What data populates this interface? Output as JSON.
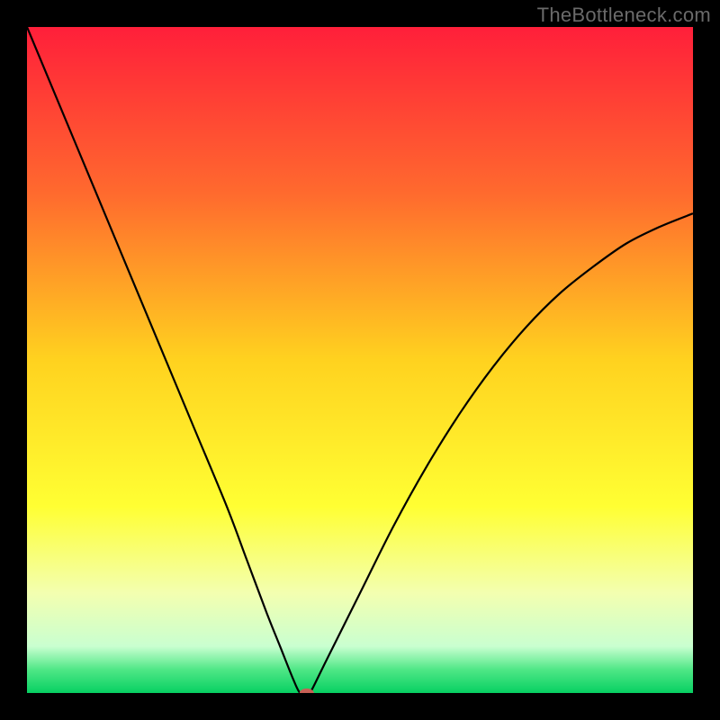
{
  "watermark": "TheBottleneck.com",
  "chart_data": {
    "type": "line",
    "title": "",
    "xlabel": "",
    "ylabel": "",
    "xlim": [
      0,
      100
    ],
    "ylim": [
      0,
      100
    ],
    "grid": false,
    "legend": false,
    "series": [
      {
        "name": "curve",
        "x": [
          0,
          5,
          10,
          15,
          20,
          25,
          30,
          33,
          36,
          38,
          40,
          41,
          42,
          42.5,
          45,
          50,
          55,
          60,
          65,
          70,
          75,
          80,
          85,
          90,
          95,
          100
        ],
        "y": [
          100,
          88,
          76,
          64,
          52,
          40,
          28,
          20,
          12,
          7,
          2,
          0,
          0,
          0,
          5,
          15,
          25,
          34,
          42,
          49,
          55,
          60,
          64,
          67.5,
          70,
          72
        ]
      }
    ],
    "marker": {
      "x": 42,
      "y": 0,
      "color": "#c76055",
      "rx": 8,
      "ry": 5
    },
    "background_gradient": {
      "stops": [
        {
          "offset": 0.0,
          "color": "#ff1f3a"
        },
        {
          "offset": 0.25,
          "color": "#ff6a2e"
        },
        {
          "offset": 0.5,
          "color": "#ffd21f"
        },
        {
          "offset": 0.72,
          "color": "#ffff33"
        },
        {
          "offset": 0.85,
          "color": "#f3ffb0"
        },
        {
          "offset": 0.93,
          "color": "#c9ffd0"
        },
        {
          "offset": 0.965,
          "color": "#4fe786"
        },
        {
          "offset": 1.0,
          "color": "#07d062"
        }
      ]
    }
  }
}
